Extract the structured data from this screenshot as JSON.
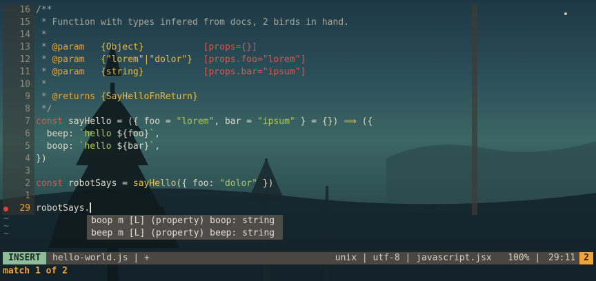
{
  "editor": {
    "lines": [
      {
        "ln": "16",
        "tokens": [
          {
            "t": "/**",
            "c": "c-comment"
          }
        ]
      },
      {
        "ln": "15",
        "tokens": [
          {
            "t": " * Function with types infered from docs, 2 birds in hand.",
            "c": "c-comment"
          }
        ]
      },
      {
        "ln": "14",
        "tokens": [
          {
            "t": " *",
            "c": "c-comment"
          }
        ]
      },
      {
        "ln": "13",
        "tokens": [
          {
            "t": " * ",
            "c": "c-comment"
          },
          {
            "t": "@param",
            "c": "c-tag"
          },
          {
            "t": "   ",
            "c": "c-comment"
          },
          {
            "t": "{Object}",
            "c": "c-type"
          },
          {
            "t": "           ",
            "c": "c-comment"
          },
          {
            "t": "[props={}]",
            "c": "c-param"
          }
        ]
      },
      {
        "ln": "12",
        "tokens": [
          {
            "t": " * ",
            "c": "c-comment"
          },
          {
            "t": "@param",
            "c": "c-tag"
          },
          {
            "t": "   ",
            "c": "c-comment"
          },
          {
            "t": "{\"lorem\"|\"dolor\"}",
            "c": "c-type"
          },
          {
            "t": "  ",
            "c": "c-comment"
          },
          {
            "t": "[props.foo=\"lorem\"]",
            "c": "c-param"
          }
        ]
      },
      {
        "ln": "11",
        "tokens": [
          {
            "t": " * ",
            "c": "c-comment"
          },
          {
            "t": "@param",
            "c": "c-tag"
          },
          {
            "t": "   ",
            "c": "c-comment"
          },
          {
            "t": "{string}",
            "c": "c-type"
          },
          {
            "t": "           ",
            "c": "c-comment"
          },
          {
            "t": "[props.bar=\"ipsum\"]",
            "c": "c-param"
          }
        ]
      },
      {
        "ln": "10",
        "tokens": [
          {
            "t": " *",
            "c": "c-comment"
          }
        ]
      },
      {
        "ln": "9",
        "tokens": [
          {
            "t": " * ",
            "c": "c-comment"
          },
          {
            "t": "@returns",
            "c": "c-tag"
          },
          {
            "t": " ",
            "c": "c-comment"
          },
          {
            "t": "{SayHelloFnReturn}",
            "c": "c-type"
          }
        ]
      },
      {
        "ln": "8",
        "tokens": [
          {
            "t": " */",
            "c": "c-comment"
          }
        ]
      },
      {
        "ln": "7",
        "tokens": [
          {
            "t": "const",
            "c": "c-kw"
          },
          {
            "t": " sayHello = ({ foo = ",
            "c": "c-plain"
          },
          {
            "t": "\"lorem\"",
            "c": "c-str"
          },
          {
            "t": ", bar = ",
            "c": "c-plain"
          },
          {
            "t": "\"ipsum\"",
            "c": "c-str"
          },
          {
            "t": " } = {}) ",
            "c": "c-plain"
          },
          {
            "t": "⟹",
            "c": "c-func"
          },
          {
            "t": " ({",
            "c": "c-plain"
          }
        ]
      },
      {
        "ln": "6",
        "tokens": [
          {
            "t": "  beep: ",
            "c": "c-plain"
          },
          {
            "t": "`hello ",
            "c": "c-str"
          },
          {
            "t": "${foo}",
            "c": "c-plain"
          },
          {
            "t": "`",
            "c": "c-str"
          },
          {
            "t": ",",
            "c": "c-plain"
          }
        ]
      },
      {
        "ln": "5",
        "tokens": [
          {
            "t": "  boop: ",
            "c": "c-plain"
          },
          {
            "t": "`hello ",
            "c": "c-str"
          },
          {
            "t": "${bar}",
            "c": "c-plain"
          },
          {
            "t": "`",
            "c": "c-str"
          },
          {
            "t": ",",
            "c": "c-plain"
          }
        ]
      },
      {
        "ln": "4",
        "tokens": [
          {
            "t": "})",
            "c": "c-plain"
          }
        ]
      },
      {
        "ln": "3",
        "tokens": []
      },
      {
        "ln": "2",
        "tokens": [
          {
            "t": "const",
            "c": "c-kw"
          },
          {
            "t": " robotSays = ",
            "c": "c-plain"
          },
          {
            "t": "sayHello",
            "c": "c-func"
          },
          {
            "t": "({ foo: ",
            "c": "c-plain"
          },
          {
            "t": "\"dolor\"",
            "c": "c-str"
          },
          {
            "t": " })",
            "c": "c-plain"
          }
        ]
      },
      {
        "ln": "1",
        "tokens": []
      },
      {
        "ln": "29",
        "current": true,
        "tokens": [
          {
            "t": "robotSays.",
            "c": "c-plain"
          }
        ]
      }
    ],
    "tildes": [
      "~",
      "~",
      "~"
    ]
  },
  "completion": {
    "items": [
      "boop m [L] (property) boop: string",
      "beep m [L] (property) beep: string"
    ]
  },
  "statusline": {
    "mode": "INSERT",
    "file": "hello-world.js | +",
    "format": "unix",
    "encoding": "utf-8",
    "filetype": "javascript.jsx",
    "percent": "100%",
    "position": "29:11",
    "count": "2",
    "sep": " | "
  },
  "cmdline": {
    "message": "match 1 of 2"
  },
  "colors": {
    "mode_bg": "#8dbd9b",
    "accent": "#f2a33a",
    "sign": "#e0413a"
  }
}
